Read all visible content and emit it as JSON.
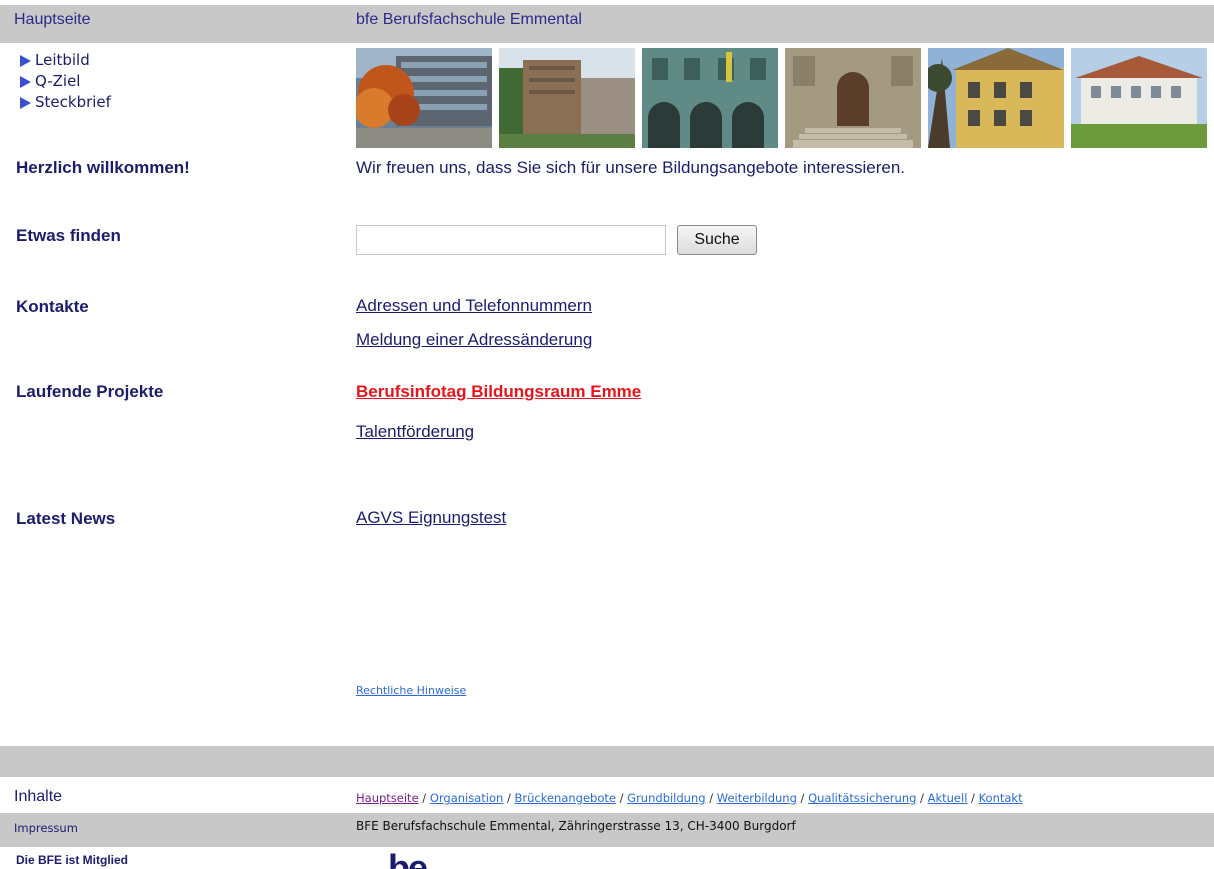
{
  "header": {
    "left_title": "Hauptseite",
    "right_title": "bfe Berufsfachschule Emmental"
  },
  "sidenav": {
    "items": [
      {
        "label": "Leitbild"
      },
      {
        "label": "Q-Ziel"
      },
      {
        "label": "Steckbrief"
      }
    ]
  },
  "photos": [
    {
      "name": "building-autumn-photo"
    },
    {
      "name": "brown-building-photo"
    },
    {
      "name": "arcade-building-photo"
    },
    {
      "name": "stone-entrance-photo"
    },
    {
      "name": "yellow-building-photo"
    },
    {
      "name": "white-building-photo"
    }
  ],
  "welcome": {
    "label": "Herzlich willkommen!",
    "text": "Wir freuen uns, dass Sie sich für unsere Bildungsangebote interessieren."
  },
  "search": {
    "label": "Etwas finden",
    "value": "",
    "button": "Suche"
  },
  "contacts": {
    "label": "Kontakte",
    "links": [
      "Adressen und Telefonnummern",
      "Meldung einer Adressänderung"
    ]
  },
  "projects": {
    "label": "Laufende Projekte",
    "highlight": "Berufsinfotag Bildungsraum Emme",
    "link": "Talentförderung"
  },
  "news": {
    "label": "Latest News",
    "link": "AGVS Eignungstest"
  },
  "legal": {
    "link": "Rechtliche Hinweise"
  },
  "footer": {
    "inhalte_label": "Inhalte",
    "nav": [
      "Hauptseite",
      "Organisation",
      "Brückenangebote",
      "Grundbildung",
      "Weiterbildung",
      "Qualitätssicherung",
      "Aktuell",
      "Kontakt"
    ],
    "separator": " / ",
    "impressum_label": "Impressum",
    "address": "BFE Berufsfachschule Emmental, Zähringerstrasse 13, CH-3400 Burgdorf",
    "member_text": "Die BFE ist Mitglied",
    "logo_text": "be"
  },
  "colors": {
    "bar_gray": "#c8c8c8",
    "text_navy": "#1c1c6e",
    "highlight_red": "#e8141c",
    "link_blue": "#2a6ad8",
    "nav_arrow": "#3a4fd0"
  }
}
